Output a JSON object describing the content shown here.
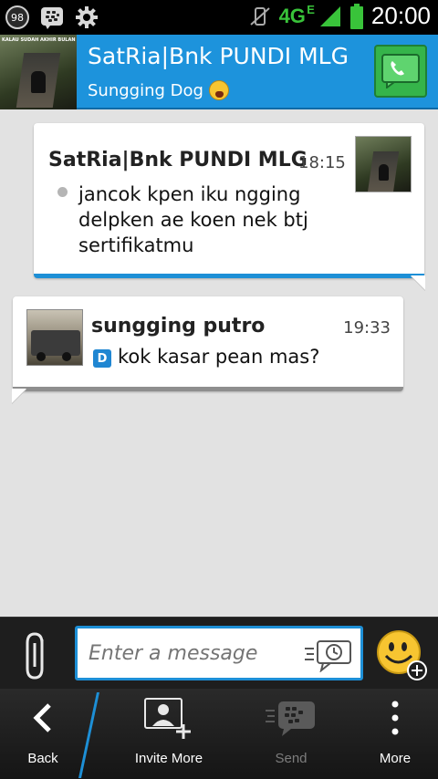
{
  "status_bar": {
    "notification_count": "98",
    "network": "4G",
    "network_sub": "E",
    "time": "20:00"
  },
  "header": {
    "contact_name": "SatRia|Bnk PUNDI MLG",
    "status_message": "Sungging Dog",
    "avatar_caption": "KALAU SUDAH AKHIR BULAN",
    "call_icon": "phone-icon"
  },
  "messages": [
    {
      "sender": "SatRia|Bnk PUNDI MLG",
      "time": "18:15",
      "text": "jancok kpen iku ngging delpken ae koen nek btj sertifikatmu",
      "direction": "incoming",
      "accent_color": "#1d8fd6"
    },
    {
      "sender": "sungging putro",
      "time": "19:33",
      "text": "kok kasar pean mas?",
      "status_glyph": "D",
      "direction": "outgoing",
      "accent_color": "#8e8e8e"
    }
  ],
  "composer": {
    "placeholder": "Enter a message"
  },
  "action_bar": {
    "back_label": "Back",
    "invite_label": "Invite More",
    "send_label": "Send",
    "more_label": "More"
  },
  "colors": {
    "accent": "#1d93dc",
    "call_green": "#35b44a",
    "network_green": "#39c33a"
  }
}
